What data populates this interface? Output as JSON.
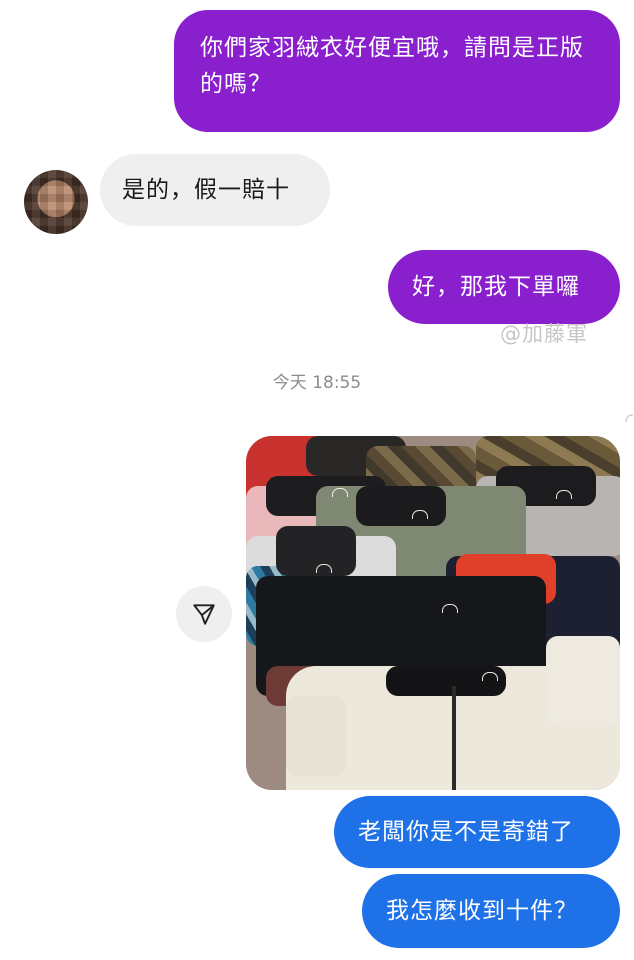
{
  "messages": {
    "m1": "你們家羽絨衣好便宜哦，請問是正版的嗎？",
    "m2": "是的，假一賠十",
    "m3": "好，那我下單囉",
    "m4": "老闆你是不是寄錯了",
    "m5": "我怎麼收到十件？"
  },
  "watermark": "@加藤軍",
  "timestamp": "今天 18:55",
  "icons": {
    "avatar": "pixelated-avatar",
    "share": "send-share-icon"
  },
  "colors": {
    "outgoing_purple": "#8a1fce",
    "outgoing_blue": "#1f71e8",
    "incoming_gray": "#efefef"
  }
}
